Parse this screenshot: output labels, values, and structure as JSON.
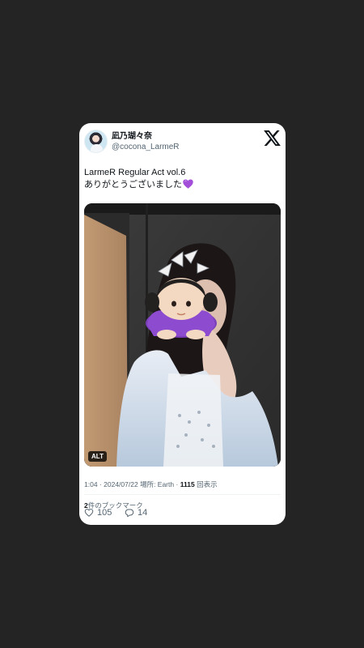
{
  "tweet": {
    "display_name": "凪乃瑚々奈",
    "handle": "@cocona_LarmeR",
    "text_line1": "LarmeR Regular Act vol.6",
    "text_line2": "ありがとうございました",
    "text_emoji": "purple-heart-icon",
    "alt_label": "ALT",
    "time": "1:04",
    "date": "2024/07/22",
    "location_label": "場所: Earth",
    "views_count": "1115",
    "views_label": "回表示",
    "bookmarks_count": "2",
    "bookmarks_label": "件のブックマーク",
    "likes": "105",
    "replies": "14"
  },
  "colors": {
    "background": "#242424",
    "card": "#ffffff",
    "text_primary": "#0f1419",
    "text_secondary": "#536471",
    "heart_purple": "#a24ed8"
  },
  "icons": [
    "x-logo-icon",
    "heart-icon",
    "reply-icon",
    "purple-heart-icon"
  ]
}
